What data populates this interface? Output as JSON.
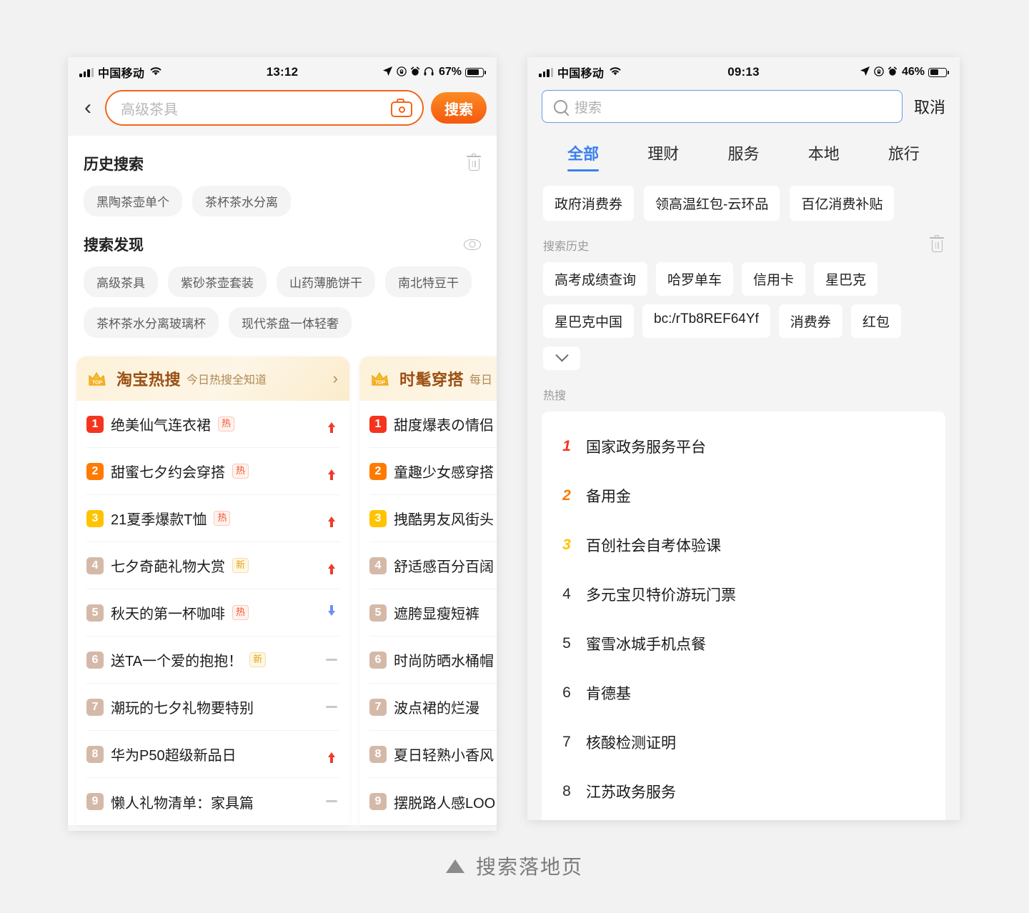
{
  "caption": {
    "text": "搜索落地页"
  },
  "left_phone": {
    "status_bar": {
      "carrier": "中国移动",
      "time": "13:12",
      "battery_pct": "67%"
    },
    "search": {
      "value": "高级茶具",
      "camera_icon": "camera-icon",
      "button_label": "搜索",
      "back_icon": "back-chevron-icon"
    },
    "history": {
      "title": "历史搜索",
      "clear_icon": "trash-icon",
      "items": [
        "黑陶茶壶单个",
        "茶杯茶水分离"
      ]
    },
    "discover": {
      "title": "搜索发现",
      "toggle_icon": "eye-icon",
      "items": [
        "高级茶具",
        "紫砂茶壶套装",
        "山药薄脆饼干",
        "南北特豆干",
        "茶杯茶水分离玻璃杯",
        "现代茶盘一体轻奢"
      ]
    },
    "cards": [
      {
        "title": "淘宝热搜",
        "subtitle": "今日热搜全知道",
        "badge_icon": "crown-top-icon",
        "arrow_icon": "chevron-right-icon",
        "items": [
          {
            "rank": "1",
            "text": "绝美仙气连衣裙",
            "tag": "热",
            "tag_type": "hot",
            "trend": "up"
          },
          {
            "rank": "2",
            "text": "甜蜜七夕约会穿搭",
            "tag": "热",
            "tag_type": "hot",
            "trend": "up"
          },
          {
            "rank": "3",
            "text": "21夏季爆款T恤",
            "tag": "热",
            "tag_type": "hot",
            "trend": "up"
          },
          {
            "rank": "4",
            "text": "七夕奇葩礼物大赏",
            "tag": "新",
            "tag_type": "new",
            "trend": "up"
          },
          {
            "rank": "5",
            "text": "秋天的第一杯咖啡",
            "tag": "热",
            "tag_type": "hot",
            "trend": "down"
          },
          {
            "rank": "6",
            "text": "送TA一个爱的抱抱！",
            "tag": "新",
            "tag_type": "new",
            "trend": "flat"
          },
          {
            "rank": "7",
            "text": "潮玩的七夕礼物要特别",
            "tag": "",
            "tag_type": "",
            "trend": "flat"
          },
          {
            "rank": "8",
            "text": "华为P50超级新品日",
            "tag": "",
            "tag_type": "",
            "trend": "up"
          },
          {
            "rank": "9",
            "text": "懒人礼物清单：家具篇",
            "tag": "",
            "tag_type": "",
            "trend": "flat"
          }
        ]
      },
      {
        "title": "时髦穿搭",
        "subtitle": "每日",
        "badge_icon": "crown-top-icon",
        "arrow_icon": "chevron-right-icon",
        "items": [
          {
            "rank": "1",
            "text": "甜度爆表の情侣",
            "tag": "",
            "tag_type": "",
            "trend": "none"
          },
          {
            "rank": "2",
            "text": "童趣少女感穿搭",
            "tag": "",
            "tag_type": "",
            "trend": "none"
          },
          {
            "rank": "3",
            "text": "拽酷男友风街头",
            "tag": "",
            "tag_type": "",
            "trend": "none"
          },
          {
            "rank": "4",
            "text": "舒适感百分百阔",
            "tag": "",
            "tag_type": "",
            "trend": "none"
          },
          {
            "rank": "5",
            "text": "遮胯显瘦短裤",
            "tag": "",
            "tag_type": "",
            "trend": "none"
          },
          {
            "rank": "6",
            "text": "时尚防晒水桶帽",
            "tag": "",
            "tag_type": "",
            "trend": "none"
          },
          {
            "rank": "7",
            "text": "波点裙的烂漫",
            "tag": "",
            "tag_type": "",
            "trend": "none"
          },
          {
            "rank": "8",
            "text": "夏日轻熟小香风",
            "tag": "",
            "tag_type": "",
            "trend": "none"
          },
          {
            "rank": "9",
            "text": "摆脱路人感LOO",
            "tag": "",
            "tag_type": "",
            "trend": "none"
          }
        ]
      }
    ]
  },
  "right_phone": {
    "status_bar": {
      "carrier": "中国移动",
      "time": "09:13",
      "battery_pct": "46%"
    },
    "search": {
      "placeholder": "搜索",
      "search_icon": "search-icon",
      "cancel_label": "取消"
    },
    "tabs": [
      {
        "label": "全部",
        "active": true
      },
      {
        "label": "理财",
        "active": false
      },
      {
        "label": "服务",
        "active": false
      },
      {
        "label": "本地",
        "active": false
      },
      {
        "label": "旅行",
        "active": false
      }
    ],
    "promos": [
      "政府消费券",
      "领高温红包-云环品",
      "百亿消费补贴"
    ],
    "history": {
      "label": "搜索历史",
      "clear_icon": "trash-icon",
      "expand_icon": "chevron-down-icon",
      "items": [
        "高考成绩查询",
        "哈罗单车",
        "信用卡",
        "星巴克",
        "星巴克中国",
        "bc:/rTb8REF64Yf",
        "消费券",
        "红包"
      ]
    },
    "hot": {
      "label": "热搜",
      "items": [
        {
          "rank": "1",
          "text": "国家政务服务平台"
        },
        {
          "rank": "2",
          "text": "备用金"
        },
        {
          "rank": "3",
          "text": "百创社会自考体验课"
        },
        {
          "rank": "4",
          "text": "多元宝贝特价游玩门票"
        },
        {
          "rank": "5",
          "text": "蜜雪冰城手机点餐"
        },
        {
          "rank": "6",
          "text": "肯德基"
        },
        {
          "rank": "7",
          "text": "核酸检测证明"
        },
        {
          "rank": "8",
          "text": "江苏政务服务"
        }
      ]
    }
  },
  "colors": {
    "orange": "#f4651a",
    "blue": "#3a7fef",
    "rank1": "#f5341f",
    "rank2": "#ff7a00",
    "rank3": "#ffc300",
    "rank_rest": "#d5b9a8",
    "trend_up": "#ef3a2e",
    "trend_down": "#6f8ff0"
  }
}
